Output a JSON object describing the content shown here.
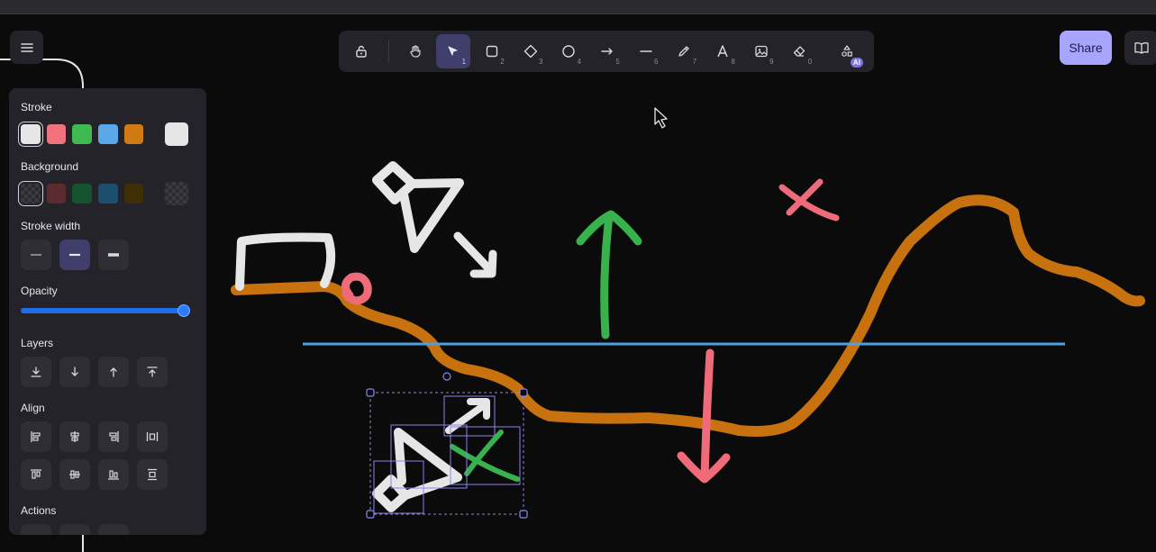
{
  "toolbar": {
    "tools": [
      {
        "name": "lock",
        "key": ""
      },
      {
        "name": "hand",
        "key": ""
      },
      {
        "name": "selection",
        "key": "1",
        "active": true
      },
      {
        "name": "rectangle",
        "key": "2"
      },
      {
        "name": "diamond",
        "key": "3"
      },
      {
        "name": "ellipse",
        "key": "4"
      },
      {
        "name": "arrow",
        "key": "5"
      },
      {
        "name": "line",
        "key": "6"
      },
      {
        "name": "draw",
        "key": "7"
      },
      {
        "name": "text",
        "key": "8"
      },
      {
        "name": "image",
        "key": "9"
      },
      {
        "name": "eraser",
        "key": "0"
      },
      {
        "name": "more-tools",
        "key": ""
      }
    ],
    "ai_badge": "AI"
  },
  "share_label": "Share",
  "panel": {
    "stroke_label": "Stroke",
    "stroke_colors": [
      "#e6e6e6",
      "#f0727d",
      "#3fb950",
      "#5aa8e8",
      "#cf7a12"
    ],
    "stroke_current": "#e6e6e6",
    "background_label": "Background",
    "background_colors": [
      "transparent",
      "#5c2b2f",
      "#14532d",
      "#1d4e6f",
      "#3f2e08"
    ],
    "stroke_width_label": "Stroke width",
    "opacity_label": "Opacity",
    "opacity_value": 100,
    "layers_label": "Layers",
    "align_label": "Align",
    "actions_label": "Actions"
  },
  "colors": {
    "accent": "#a8a5ff",
    "panel_bg": "#232329",
    "canvas_bg": "#0b0b0c",
    "orange_stroke": "#c8720f",
    "blue_line": "#4d9fe0",
    "green_stroke": "#37b24d",
    "pink_stroke": "#f06b7a",
    "white_stroke": "#e6e6e6"
  }
}
